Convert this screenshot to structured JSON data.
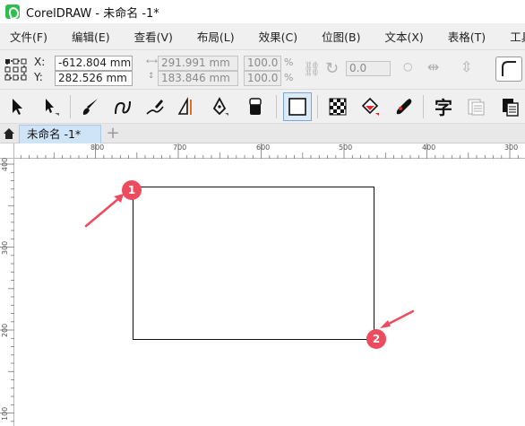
{
  "window": {
    "title": "CorelDRAW - 未命名 -1*"
  },
  "menu": [
    {
      "label": "文件(F)"
    },
    {
      "label": "编辑(E)"
    },
    {
      "label": "查看(V)"
    },
    {
      "label": "布局(L)"
    },
    {
      "label": "效果(C)"
    },
    {
      "label": "位图(B)"
    },
    {
      "label": "文本(X)"
    },
    {
      "label": "表格(T)"
    },
    {
      "label": "工具(O)"
    }
  ],
  "property_bar": {
    "x_label": "X:",
    "y_label": "Y:",
    "x_value": "-612.804 mm",
    "y_value": "282.526 mm",
    "width_value": "291.991 mm",
    "height_value": "183.846 mm",
    "scale_x": "100.0",
    "scale_y": "100.0",
    "percent": "%",
    "rotation_value": "0.0"
  },
  "toolbox": [
    {
      "icon": "pick-tool-icon"
    },
    {
      "icon": "shape-tool-icon"
    },
    {
      "icon": "artistic-media-icon"
    },
    {
      "icon": "freehand-tool-icon"
    },
    {
      "icon": "smart-drawing-icon"
    },
    {
      "icon": "dimension-tool-icon"
    },
    {
      "icon": "pen-tool-icon"
    },
    {
      "icon": "eraser-icon"
    },
    {
      "icon": "rectangle-tool-icon"
    },
    {
      "icon": "transparency-tool-icon"
    },
    {
      "icon": "interactive-fill-icon"
    },
    {
      "icon": "eyedropper-icon"
    },
    {
      "icon": "text-tool-icon"
    },
    {
      "icon": "table-tool-icon"
    },
    {
      "icon": "copy-properties-icon"
    }
  ],
  "tabs": {
    "document": "未命名 -1*",
    "add": "+"
  },
  "ruler": {
    "horizontal": [
      "800",
      "700",
      "600",
      "500",
      "400",
      "300"
    ],
    "vertical": [
      "400",
      "300",
      "200",
      "100"
    ]
  },
  "markers": [
    {
      "label": "1"
    },
    {
      "label": "2"
    }
  ],
  "colors": {
    "marker": "#ee4c5e",
    "accent": "#2dbe4e",
    "tab": "#cfe4f7"
  }
}
